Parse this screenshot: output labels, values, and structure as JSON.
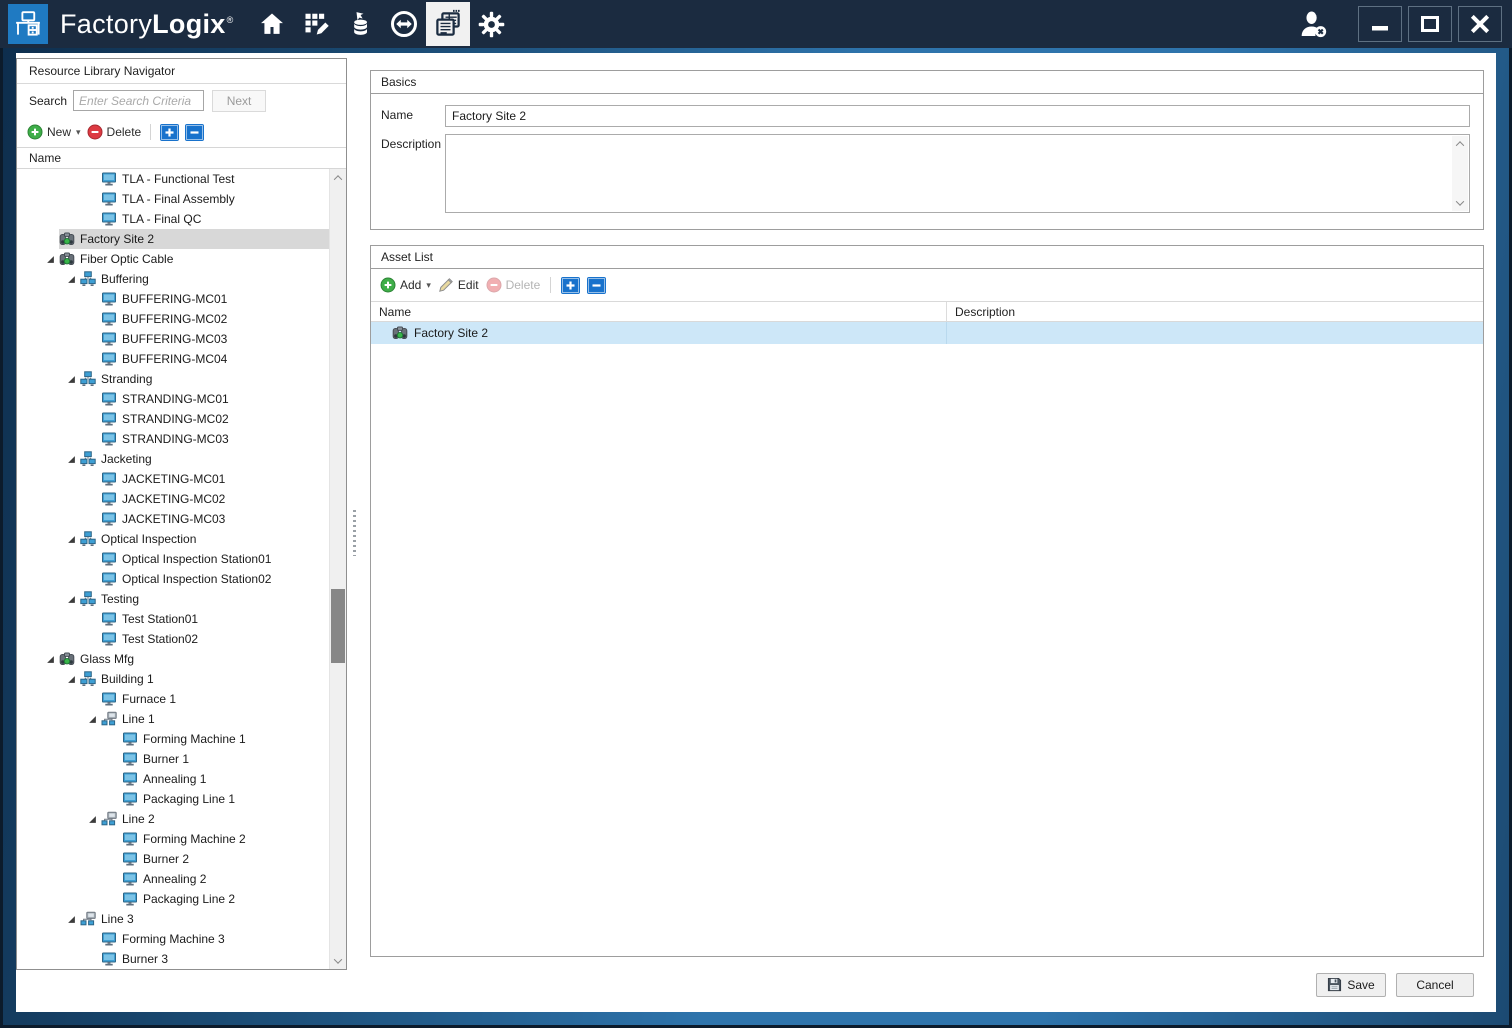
{
  "titlebar": {
    "brand_light": "Factory",
    "brand_bold": "Logix",
    "registered": "®",
    "nav": [
      {
        "name": "home-icon",
        "active": false
      },
      {
        "name": "planning-grid-pencil-icon",
        "active": false
      },
      {
        "name": "materials-stack-icon",
        "active": false
      },
      {
        "name": "transfer-circle-arrows-icon",
        "active": false
      },
      {
        "name": "production-forms-icon",
        "active": true
      },
      {
        "name": "settings-gear-icon",
        "active": false
      }
    ],
    "window_controls": [
      "logout-user-icon",
      "minimize-icon",
      "maximize-icon",
      "close-icon"
    ]
  },
  "left_panel": {
    "title": "Resource Library Navigator",
    "search_label": "Search",
    "search_placeholder": "Enter Search Criteria",
    "next_label": "Next",
    "new_label": "New",
    "delete_label": "Delete",
    "column_header": "Name",
    "tree": [
      {
        "label": "TLA - Functional Test",
        "level": 3,
        "icon": "machine"
      },
      {
        "label": "TLA - Final Assembly",
        "level": 3,
        "icon": "machine"
      },
      {
        "label": "TLA - Final QC",
        "level": 3,
        "icon": "machine"
      },
      {
        "label": "Factory Site 2",
        "level": 1,
        "icon": "site",
        "selected": true
      },
      {
        "label": "Fiber Optic Cable",
        "level": 1,
        "icon": "site",
        "expanded": true
      },
      {
        "label": "Buffering",
        "level": 2,
        "icon": "group",
        "expanded": true
      },
      {
        "label": "BUFFERING-MC01",
        "level": 3,
        "icon": "machine"
      },
      {
        "label": "BUFFERING-MC02",
        "level": 3,
        "icon": "machine"
      },
      {
        "label": "BUFFERING-MC03",
        "level": 3,
        "icon": "machine"
      },
      {
        "label": "BUFFERING-MC04",
        "level": 3,
        "icon": "machine"
      },
      {
        "label": "Stranding",
        "level": 2,
        "icon": "group",
        "expanded": true
      },
      {
        "label": "STRANDING-MC01",
        "level": 3,
        "icon": "machine"
      },
      {
        "label": "STRANDING-MC02",
        "level": 3,
        "icon": "machine"
      },
      {
        "label": "STRANDING-MC03",
        "level": 3,
        "icon": "machine"
      },
      {
        "label": "Jacketing",
        "level": 2,
        "icon": "group",
        "expanded": true
      },
      {
        "label": "JACKETING-MC01",
        "level": 3,
        "icon": "machine"
      },
      {
        "label": "JACKETING-MC02",
        "level": 3,
        "icon": "machine"
      },
      {
        "label": "JACKETING-MC03",
        "level": 3,
        "icon": "machine"
      },
      {
        "label": "Optical Inspection",
        "level": 2,
        "icon": "group",
        "expanded": true
      },
      {
        "label": "Optical Inspection Station01",
        "level": 3,
        "icon": "machine"
      },
      {
        "label": "Optical Inspection Station02",
        "level": 3,
        "icon": "machine"
      },
      {
        "label": "Testing",
        "level": 2,
        "icon": "group",
        "expanded": true
      },
      {
        "label": "Test Station01",
        "level": 3,
        "icon": "machine"
      },
      {
        "label": "Test Station02",
        "level": 3,
        "icon": "machine"
      },
      {
        "label": "Glass Mfg",
        "level": 1,
        "icon": "site",
        "expanded": true
      },
      {
        "label": "Building 1",
        "level": 2,
        "icon": "group",
        "expanded": true
      },
      {
        "label": "Furnace 1",
        "level": 3,
        "icon": "machine"
      },
      {
        "label": "Line 1",
        "level": 3,
        "icon": "line",
        "expanded": true
      },
      {
        "label": "Forming Machine 1",
        "level": 4,
        "icon": "machine"
      },
      {
        "label": "Burner 1",
        "level": 4,
        "icon": "machine"
      },
      {
        "label": "Annealing 1",
        "level": 4,
        "icon": "machine"
      },
      {
        "label": "Packaging Line 1",
        "level": 4,
        "icon": "machine"
      },
      {
        "label": "Line 2",
        "level": 3,
        "icon": "line",
        "expanded": true
      },
      {
        "label": "Forming Machine 2",
        "level": 4,
        "icon": "machine"
      },
      {
        "label": "Burner 2",
        "level": 4,
        "icon": "machine"
      },
      {
        "label": "Annealing 2",
        "level": 4,
        "icon": "machine"
      },
      {
        "label": "Packaging Line 2",
        "level": 4,
        "icon": "machine"
      },
      {
        "label": "Line 3",
        "level": 2,
        "icon": "line",
        "expanded": true
      },
      {
        "label": "Forming Machine 3",
        "level": 3,
        "icon": "machine"
      },
      {
        "label": "Burner 3",
        "level": 3,
        "icon": "machine"
      }
    ]
  },
  "basics": {
    "title": "Basics",
    "name_label": "Name",
    "name_value": "Factory Site 2",
    "description_label": "Description",
    "description_value": ""
  },
  "asset_list": {
    "title": "Asset List",
    "add_label": "Add",
    "edit_label": "Edit",
    "delete_label": "Delete",
    "columns": [
      "Name",
      "Description"
    ],
    "rows": [
      {
        "name": "Factory Site 2",
        "description": "",
        "icon": "site",
        "selected": true
      }
    ]
  },
  "footer": {
    "save_label": "Save",
    "cancel_label": "Cancel"
  },
  "colors": {
    "titlebar": "#1b2b40",
    "accent_blue": "#2e74ac",
    "logo_blue": "#1f7ac2",
    "tree_selection": "#d8d8d8",
    "row_selection": "#cde7f8",
    "add_green": "#3fae49",
    "delete_red": "#dd3a42",
    "expand_button_blue": "#1872cc"
  }
}
